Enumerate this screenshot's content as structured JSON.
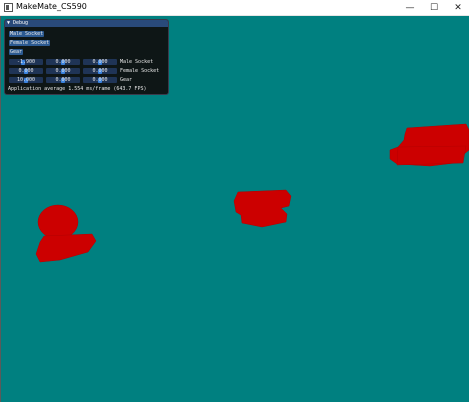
{
  "window": {
    "title": "MakeMate_CS590",
    "controls": {
      "minimize": "—",
      "maximize": "☐",
      "close": "✕"
    },
    "background_color": "#008080"
  },
  "debug_panel": {
    "title": "Debug",
    "collapse_icon": "triangle-down-icon",
    "buttons": [
      "Male Socket",
      "Female Socket",
      "Gear"
    ],
    "rows": [
      {
        "values": [
          "-1.900",
          "0.000",
          "0.000"
        ],
        "label": "Male Socket"
      },
      {
        "values": [
          "0.000",
          "0.000",
          "0.000"
        ],
        "label": "Female Socket"
      },
      {
        "values": [
          "10.000",
          "0.000",
          "0.000"
        ],
        "label": "Gear"
      }
    ],
    "footer": "Application average 1.554 ms/frame (643.7 FPS)",
    "accent_color": "#2c5a91",
    "slider_color": "#3d85e0"
  },
  "scene": {
    "object_color": "#cc0000",
    "objects": [
      "male-socket",
      "female-socket",
      "gear"
    ]
  }
}
